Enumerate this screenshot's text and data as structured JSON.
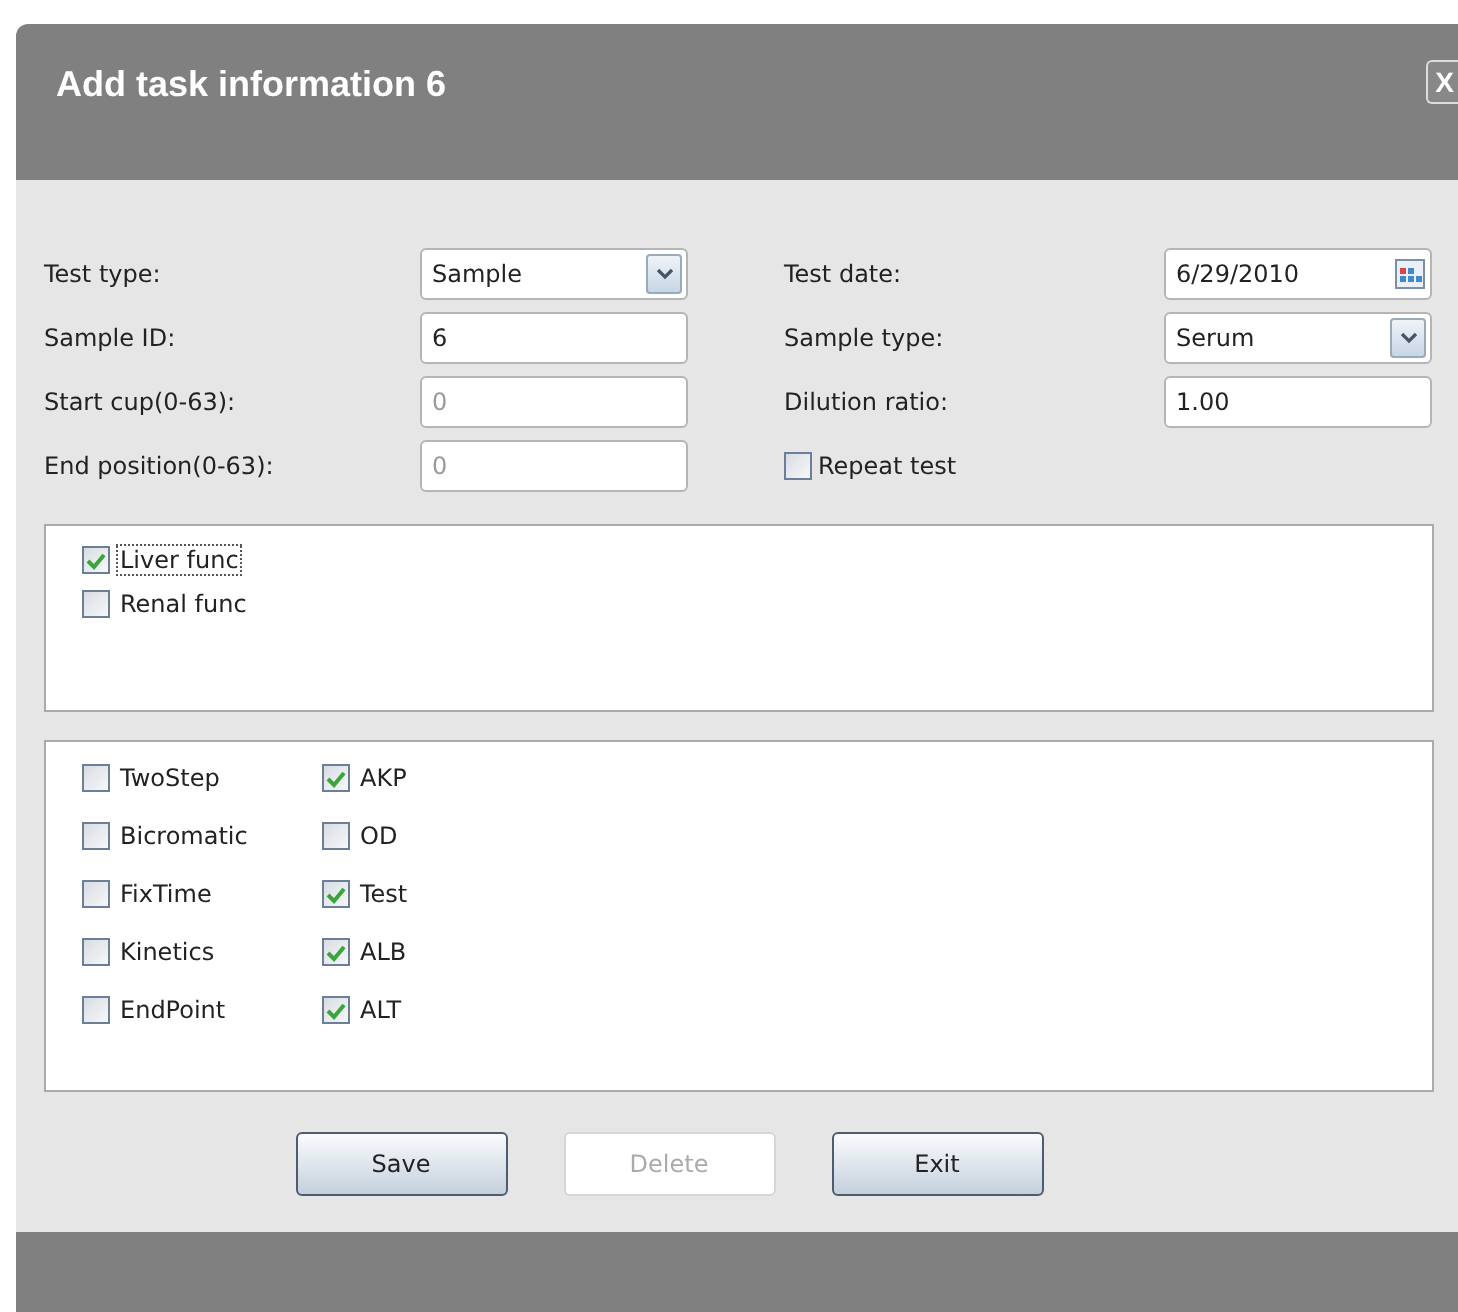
{
  "window": {
    "title": "Add task information 6",
    "close": "X"
  },
  "fields": [
    {
      "kind": "select",
      "label": "Test type:",
      "value": "Sample",
      "disabled": false
    },
    {
      "kind": "date",
      "label": "Test date:",
      "value": "6/29/2010",
      "disabled": false
    },
    {
      "kind": "text",
      "label": "Sample ID:",
      "value": "6",
      "disabled": false
    },
    {
      "kind": "select",
      "label": "Sample type:",
      "value": "Serum",
      "disabled": false
    },
    {
      "kind": "text",
      "label": "Start cup(0-63):",
      "value": "0",
      "disabled": true
    },
    {
      "kind": "text",
      "label": "Dilution ratio:",
      "value": "1.00",
      "disabled": false
    },
    {
      "kind": "text",
      "label": "End position(0-63):",
      "value": "0",
      "disabled": true
    },
    {
      "kind": "check",
      "label": "Repeat test",
      "checked": false
    }
  ],
  "groups": [
    {
      "label": "Liver func",
      "checked": true,
      "selected": true
    },
    {
      "label": "Renal func",
      "checked": false,
      "selected": false
    }
  ],
  "items": [
    {
      "label": "TwoStep",
      "checked": false
    },
    {
      "label": "Bicromatic",
      "checked": false
    },
    {
      "label": "FixTime",
      "checked": false
    },
    {
      "label": "Kinetics",
      "checked": false
    },
    {
      "label": "EndPoint",
      "checked": false
    },
    {
      "label": "AKP",
      "checked": true
    },
    {
      "label": "OD",
      "checked": false
    },
    {
      "label": "Test",
      "checked": true
    },
    {
      "label": "ALB",
      "checked": true
    },
    {
      "label": "ALT",
      "checked": true
    }
  ],
  "buttons": [
    {
      "label": "Save",
      "disabled": false
    },
    {
      "label": "Delete",
      "disabled": true
    },
    {
      "label": "Exit",
      "disabled": false
    }
  ]
}
